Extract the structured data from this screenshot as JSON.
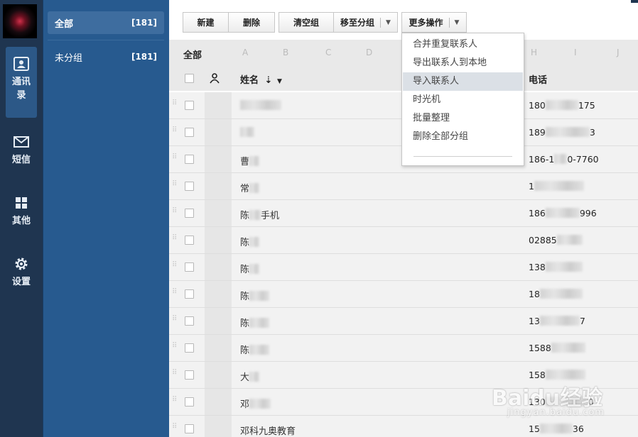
{
  "rail": {
    "items": [
      {
        "label": "通讯录",
        "icon": "address-book-icon"
      },
      {
        "label": "短信",
        "icon": "envelope-icon"
      },
      {
        "label": "其他",
        "icon": "grid-icon"
      },
      {
        "label": "设置",
        "icon": "gear-icon"
      }
    ]
  },
  "groups": {
    "items": [
      {
        "label": "全部",
        "count": "[181]"
      },
      {
        "label": "未分组",
        "count": "[181]"
      }
    ]
  },
  "toolbar": {
    "new_label": "新建",
    "delete_label": "删除",
    "clear_label": "清空组",
    "move_label": "移至分组",
    "more_label": "更多操作"
  },
  "list": {
    "title": "全部",
    "letters": [
      "A",
      "B",
      "C",
      "D",
      "H",
      "I",
      "J"
    ],
    "name_header": "姓名",
    "sort_icon": "⇣",
    "phone_header": "电话"
  },
  "menu": {
    "items": [
      "合并重复联系人",
      "导出联系人到本地",
      "导入联系人",
      "时光机",
      "批量整理",
      "删除全部分组"
    ],
    "hover_index": 2
  },
  "rows": [
    {
      "name_prefix": "",
      "name_suffix": "",
      "phone_prefix": "180",
      "phone_suffix": "175"
    },
    {
      "name_prefix": "",
      "name_suffix": "",
      "phone_prefix": "189",
      "phone_suffix": "3"
    },
    {
      "name_prefix": "曹",
      "name_suffix": "",
      "phone_prefix": "186-1",
      "phone_suffix": "0-7760"
    },
    {
      "name_prefix": "常",
      "name_suffix": "",
      "phone_prefix": "1",
      "phone_suffix": ""
    },
    {
      "name_prefix": "陈",
      "name_suffix": "手机",
      "phone_prefix": "186",
      "phone_suffix": "996"
    },
    {
      "name_prefix": "陈",
      "name_suffix": "",
      "phone_prefix": "02885",
      "phone_suffix": ""
    },
    {
      "name_prefix": "陈",
      "name_suffix": "",
      "phone_prefix": "138",
      "phone_suffix": ""
    },
    {
      "name_prefix": "陈",
      "name_suffix": "",
      "phone_prefix": "18",
      "phone_suffix": ""
    },
    {
      "name_prefix": "陈",
      "name_suffix": "",
      "phone_prefix": "13",
      "phone_suffix": "7"
    },
    {
      "name_prefix": "陈",
      "name_suffix": "",
      "phone_prefix": "1588",
      "phone_suffix": ""
    },
    {
      "name_prefix": "大",
      "name_suffix": "",
      "phone_prefix": "158",
      "phone_suffix": ""
    },
    {
      "name_prefix": "邓",
      "name_suffix": "",
      "phone_prefix": "130",
      "phone_suffix": "0"
    },
    {
      "name_prefix": "邓科九奥教育",
      "name_suffix": "",
      "phone_prefix": "15",
      "phone_suffix": "36"
    }
  ],
  "watermark": {
    "line1": "Baidu经验",
    "line2": "jingyan.baidu.com"
  }
}
